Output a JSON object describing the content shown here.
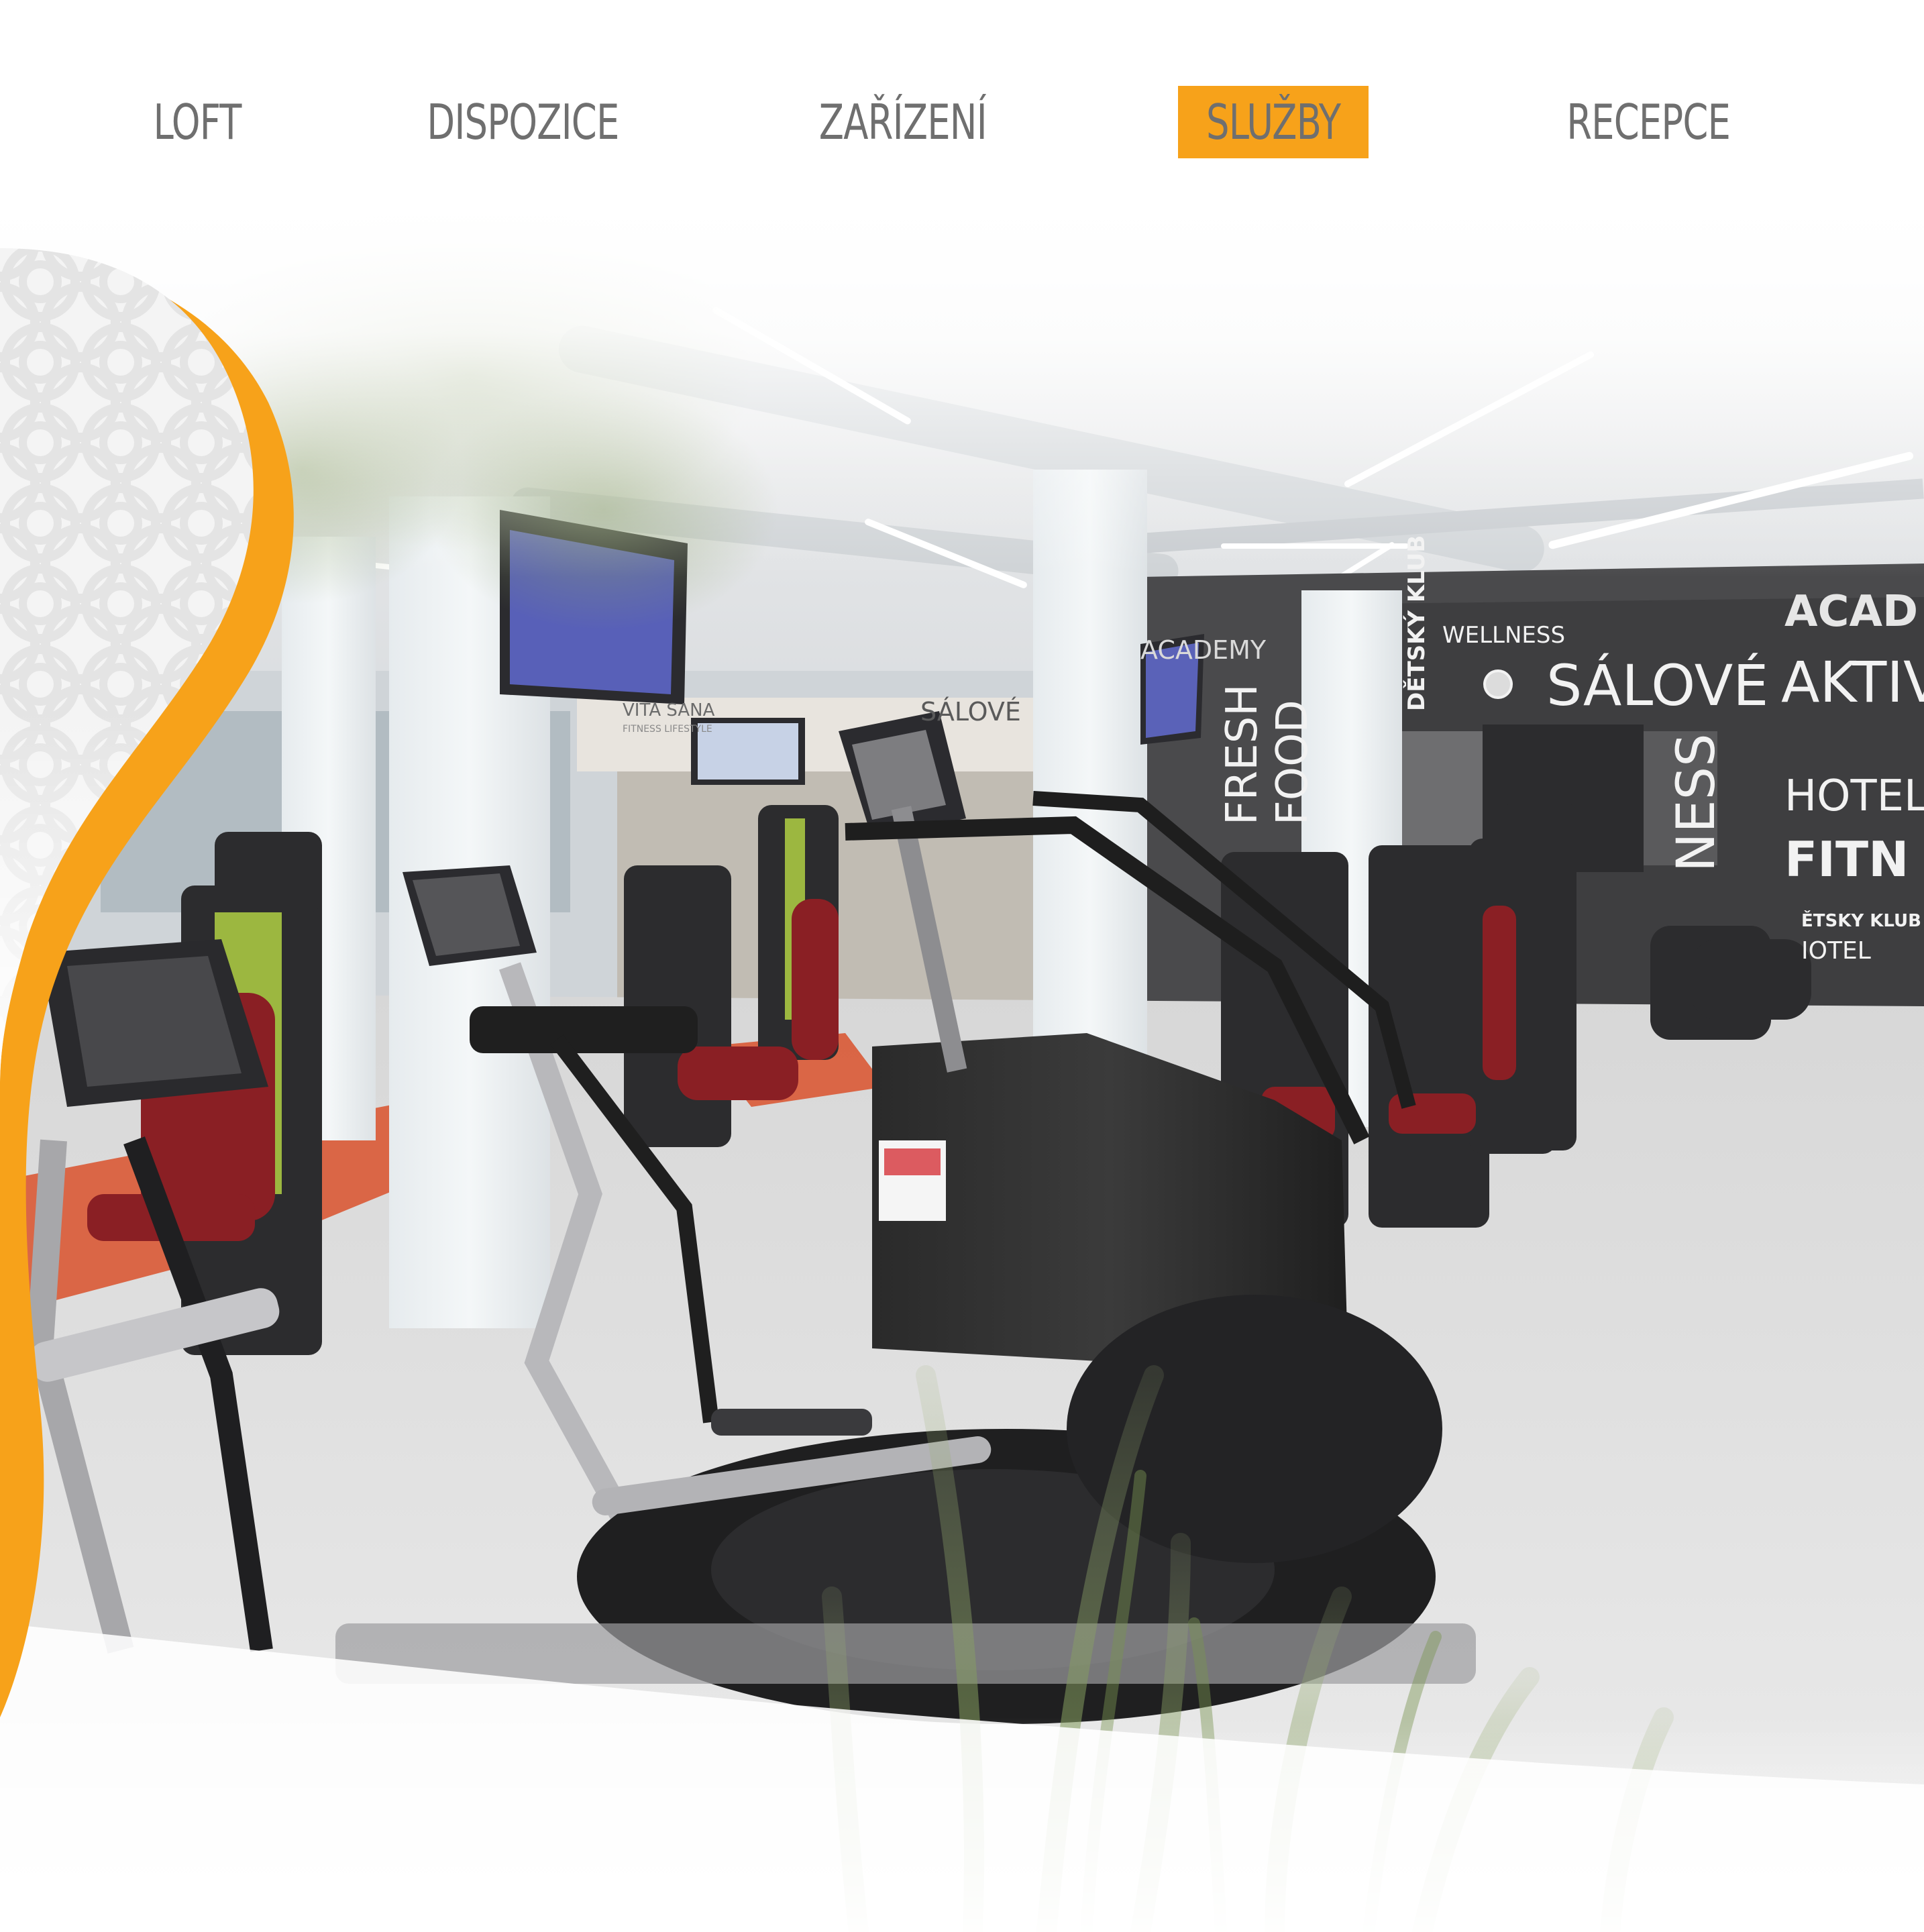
{
  "nav": {
    "items": [
      {
        "label": "LOFT",
        "active": false
      },
      {
        "label": "DISPOZICE",
        "active": false
      },
      {
        "label": "ZAŘÍZENÍ",
        "active": false
      },
      {
        "label": "SLUŽBY",
        "active": true
      },
      {
        "label": "RECEPCE",
        "active": false
      }
    ],
    "accent_color": "#f7a21a",
    "text_color": "#6f6f6f"
  },
  "hero": {
    "image_label": "fitness-gym-photo",
    "wall_signage": {
      "detsky_klub": "DĚTSKÝ KLUB",
      "wellness": "WELLNESS",
      "salove": "SÁLOVÉ",
      "aktiv": "AKTIV",
      "acad": "ACAD",
      "hotel": "HOTEL",
      "fitn": "FITN",
      "etsky_klub": "ĚTSKY KLUB",
      "iotel": "IOTEL",
      "fresh": "FRESH",
      "food": "FOOD",
      "ness": "NESS",
      "academy": "ACADEMY",
      "salove_small": "SÁLOVÉ",
      "vita_sana": "VITA SANA",
      "fitness_lifestyle": "FITNESS LIFESTYLE"
    }
  }
}
